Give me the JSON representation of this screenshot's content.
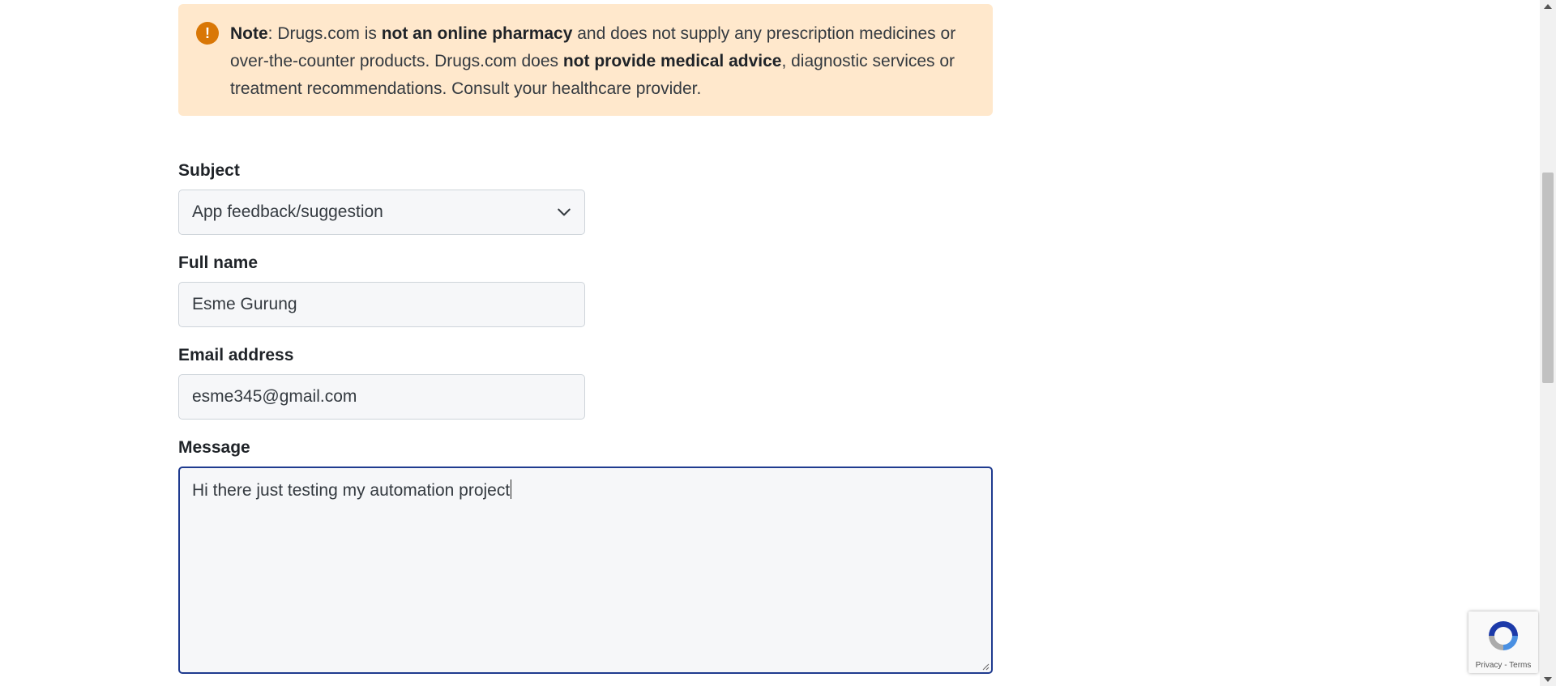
{
  "notice": {
    "icon": "exclamation-icon",
    "note_label": "Note",
    "text_1": ": Drugs.com is ",
    "bold_1": "not an online pharmacy",
    "text_2": " and does not supply any prescription medicines or over-the-counter products. Drugs.com does ",
    "bold_2": "not provide medical advice",
    "text_3": ", diagnostic services or treatment recommendations. Consult your healthcare provider."
  },
  "form": {
    "subject": {
      "label": "Subject",
      "value": "App feedback/suggestion"
    },
    "full_name": {
      "label": "Full name",
      "value": "Esme Gurung"
    },
    "email": {
      "label": "Email address",
      "value": "esme345@gmail.com"
    },
    "message": {
      "label": "Message",
      "value": "Hi there just testing my automation project"
    }
  },
  "recaptcha": {
    "links": "Privacy - Terms"
  },
  "colors": {
    "notice_bg": "#ffe8cc",
    "notice_icon": "#d97706",
    "focus_border": "#1f3b8f"
  }
}
